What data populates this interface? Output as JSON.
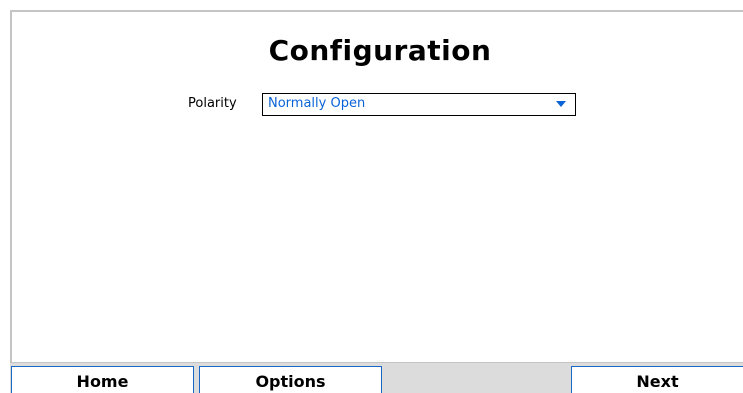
{
  "page": {
    "title": "Configuration"
  },
  "form": {
    "polarity_label": "Polarity",
    "polarity_value": "Normally Open"
  },
  "footer": {
    "home_label": "Home",
    "options_label": "Options",
    "next_label": "Next"
  },
  "colors": {
    "accent": "#0a63d6",
    "button_border": "#1a68c6",
    "footer_background": "#dcdcdc"
  },
  "icons": {
    "dropdown": "chevron-down-icon"
  }
}
